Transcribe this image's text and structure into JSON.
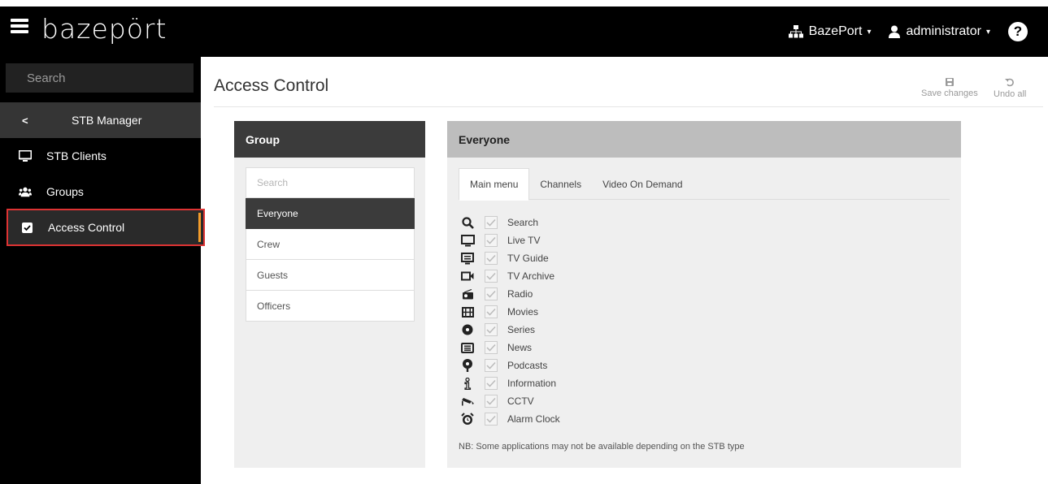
{
  "topbar": {
    "logo": "bazepört",
    "org_label": "BazePort",
    "user_label": "administrator",
    "help_label": "?",
    "caret": "▾"
  },
  "sidebar": {
    "search_placeholder": "Search",
    "back_label": "<",
    "section_title": "STB Manager",
    "items": [
      {
        "label": "STB Clients",
        "icon": "monitor-icon"
      },
      {
        "label": "Groups",
        "icon": "users-icon"
      },
      {
        "label": "Access Control",
        "icon": "checkbox-icon"
      }
    ]
  },
  "main": {
    "title": "Access Control",
    "save_label": "Save changes",
    "undo_label": "Undo all"
  },
  "group_panel": {
    "header": "Group",
    "search_placeholder": "Search",
    "groups": [
      "Everyone",
      "Crew",
      "Guests",
      "Officers"
    ]
  },
  "detail_panel": {
    "header": "Everyone",
    "tabs": [
      "Main menu",
      "Channels",
      "Video On Demand"
    ],
    "menu_items": [
      {
        "label": "Search",
        "icon": "search-icon",
        "checked": true
      },
      {
        "label": "Live TV",
        "icon": "tv-icon",
        "checked": true
      },
      {
        "label": "TV Guide",
        "icon": "guide-icon",
        "checked": true
      },
      {
        "label": "TV Archive",
        "icon": "video-camera-icon",
        "checked": true
      },
      {
        "label": "Radio",
        "icon": "radio-icon",
        "checked": true
      },
      {
        "label": "Movies",
        "icon": "film-icon",
        "checked": true
      },
      {
        "label": "Series",
        "icon": "disc-icon",
        "checked": true
      },
      {
        "label": "News",
        "icon": "newspaper-icon",
        "checked": true
      },
      {
        "label": "Podcasts",
        "icon": "podcast-icon",
        "checked": true
      },
      {
        "label": "Information",
        "icon": "info-icon",
        "checked": true
      },
      {
        "label": "CCTV",
        "icon": "cctv-icon",
        "checked": true
      },
      {
        "label": "Alarm Clock",
        "icon": "alarm-clock-icon",
        "checked": true
      }
    ],
    "note": "NB: Some applications may not be available depending on the STB type"
  },
  "colors": {
    "topbar_bg": "#000000",
    "sidebar_bg": "#000000",
    "panel_header_dark": "#3b3b3b",
    "panel_header_light": "#bdbdbd",
    "active_accent": "#f39c2b",
    "highlight_border": "#dd3333"
  }
}
